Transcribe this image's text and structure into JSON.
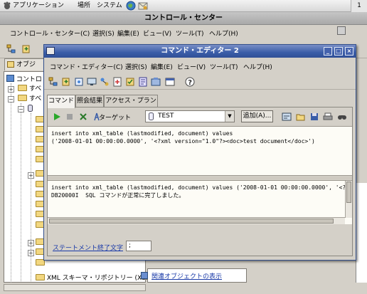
{
  "panel": {
    "applications": "アプリケーション",
    "places": "場所",
    "system": "システム",
    "right_indicator": "1"
  },
  "control_center": {
    "title": "コントロール・センター",
    "menus": [
      "コントロール・センター(C)",
      "選択(S)",
      "編集(E)",
      "ビュー(V)",
      "ツール(T)",
      "ヘルプ(H)"
    ],
    "object_tab": "オブジ",
    "tree": {
      "root": "コントロ",
      "item_all_1": "すべ",
      "item_all_2": "すべ",
      "xml_repository": "XML スキーマ・リポジトリー (XSR"
    },
    "related_objects_link": "関連オブジェクトの表示"
  },
  "command_editor": {
    "title": "コマンド・エディター 2",
    "menus": [
      "コマンド・エディター(C)",
      "選択(S)",
      "編集(E)",
      "ビュー(V)",
      "ツール(T)",
      "ヘルプ(H)"
    ],
    "tabs": [
      "コマンド",
      "照会結果",
      "アクセス・プラン"
    ],
    "target_label": "ターゲット",
    "target_value": "TEST",
    "add_button": "追加(A)...",
    "sql_lines": [
      "insert into xml_table (lastmodified, document) values",
      "('2008-01-01 00:00:00.0000', '<?xml version=\"1.0\"?><doc>test document</doc>')"
    ],
    "result_lines": [
      "insert into xml_table (lastmodified, document) values ('2008-01-01 00:00:00.0000', '<?",
      "DB20000I  SQL コマンドが正常に完了しました。"
    ],
    "stmt_terminator_label": "ステートメント終了文字",
    "stmt_terminator_value": ";"
  }
}
